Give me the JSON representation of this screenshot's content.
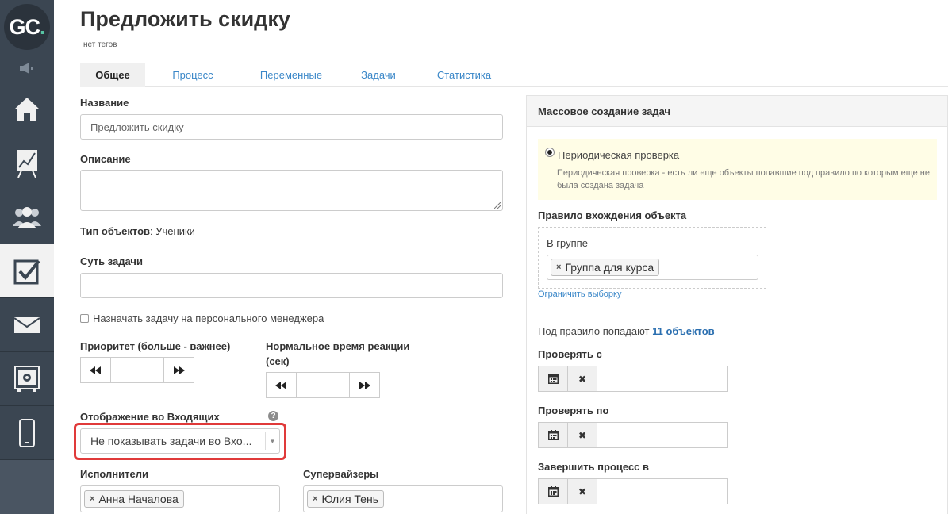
{
  "logo": {
    "text_g": "G",
    "text_c": "C",
    "text_dot": "."
  },
  "sidebar": {
    "items": [
      {
        "icon": "home-icon",
        "active": false
      },
      {
        "icon": "chart-board-icon",
        "active": false
      },
      {
        "icon": "users-icon",
        "active": false
      },
      {
        "icon": "tasks-checkbox-icon",
        "active": true
      },
      {
        "icon": "mail-icon",
        "active": false
      },
      {
        "icon": "safe-icon",
        "active": false
      },
      {
        "icon": "mobile-icon",
        "active": false
      }
    ]
  },
  "page": {
    "title": "Предложить скидку",
    "tags": "нет тегов"
  },
  "tabs": [
    "Общее",
    "Процесс",
    "Переменные",
    "Задачи",
    "Статистика"
  ],
  "form": {
    "name_label": "Название",
    "name_value": "Предложить скидку",
    "description_label": "Описание",
    "object_type_label": "Тип объектов",
    "object_type_value": ": Ученики",
    "essence_label": "Суть задачи",
    "assign_manager_label": "Назначать задачу на персонального менеджера",
    "priority_label": "Приоритет (больше - важнее)",
    "reaction_label_1": "Нормальное время реакции",
    "reaction_label_2": "(сек)",
    "inbox_label": "Отображение во Входящих",
    "help_glyph": "?",
    "inbox_value": "Не показывать задачи во Вхо...",
    "executors_label": "Исполнители",
    "executor_chip": "Анна Началова",
    "supervisors_label": "Супервайзеры",
    "supervisor_chip": "Юлия Тень",
    "chip_remove": "×"
  },
  "panel": {
    "title": "Массовое создание задач",
    "radio_label": "Периодическая проверка",
    "radio_desc": "Периодическая проверка - есть ли еще объекты попавшие под правило по которым еще не была создана задача",
    "rule_label": "Правило вхождения объекта",
    "group_label": "В группе",
    "group_chip": "Группа для курса",
    "limit_link": "Ограничить выборку",
    "match_prefix": "Под правило попадают ",
    "match_count": "11 объектов",
    "check_from_label": "Проверять с",
    "check_to_label": "Проверять по",
    "finish_label": "Завершить процесс в",
    "clear_glyph": "✖"
  },
  "colors": {
    "sidebar": "#3b4652",
    "link": "#3a87c8",
    "highlight": "#e03a3a",
    "notice": "#fffde6"
  }
}
